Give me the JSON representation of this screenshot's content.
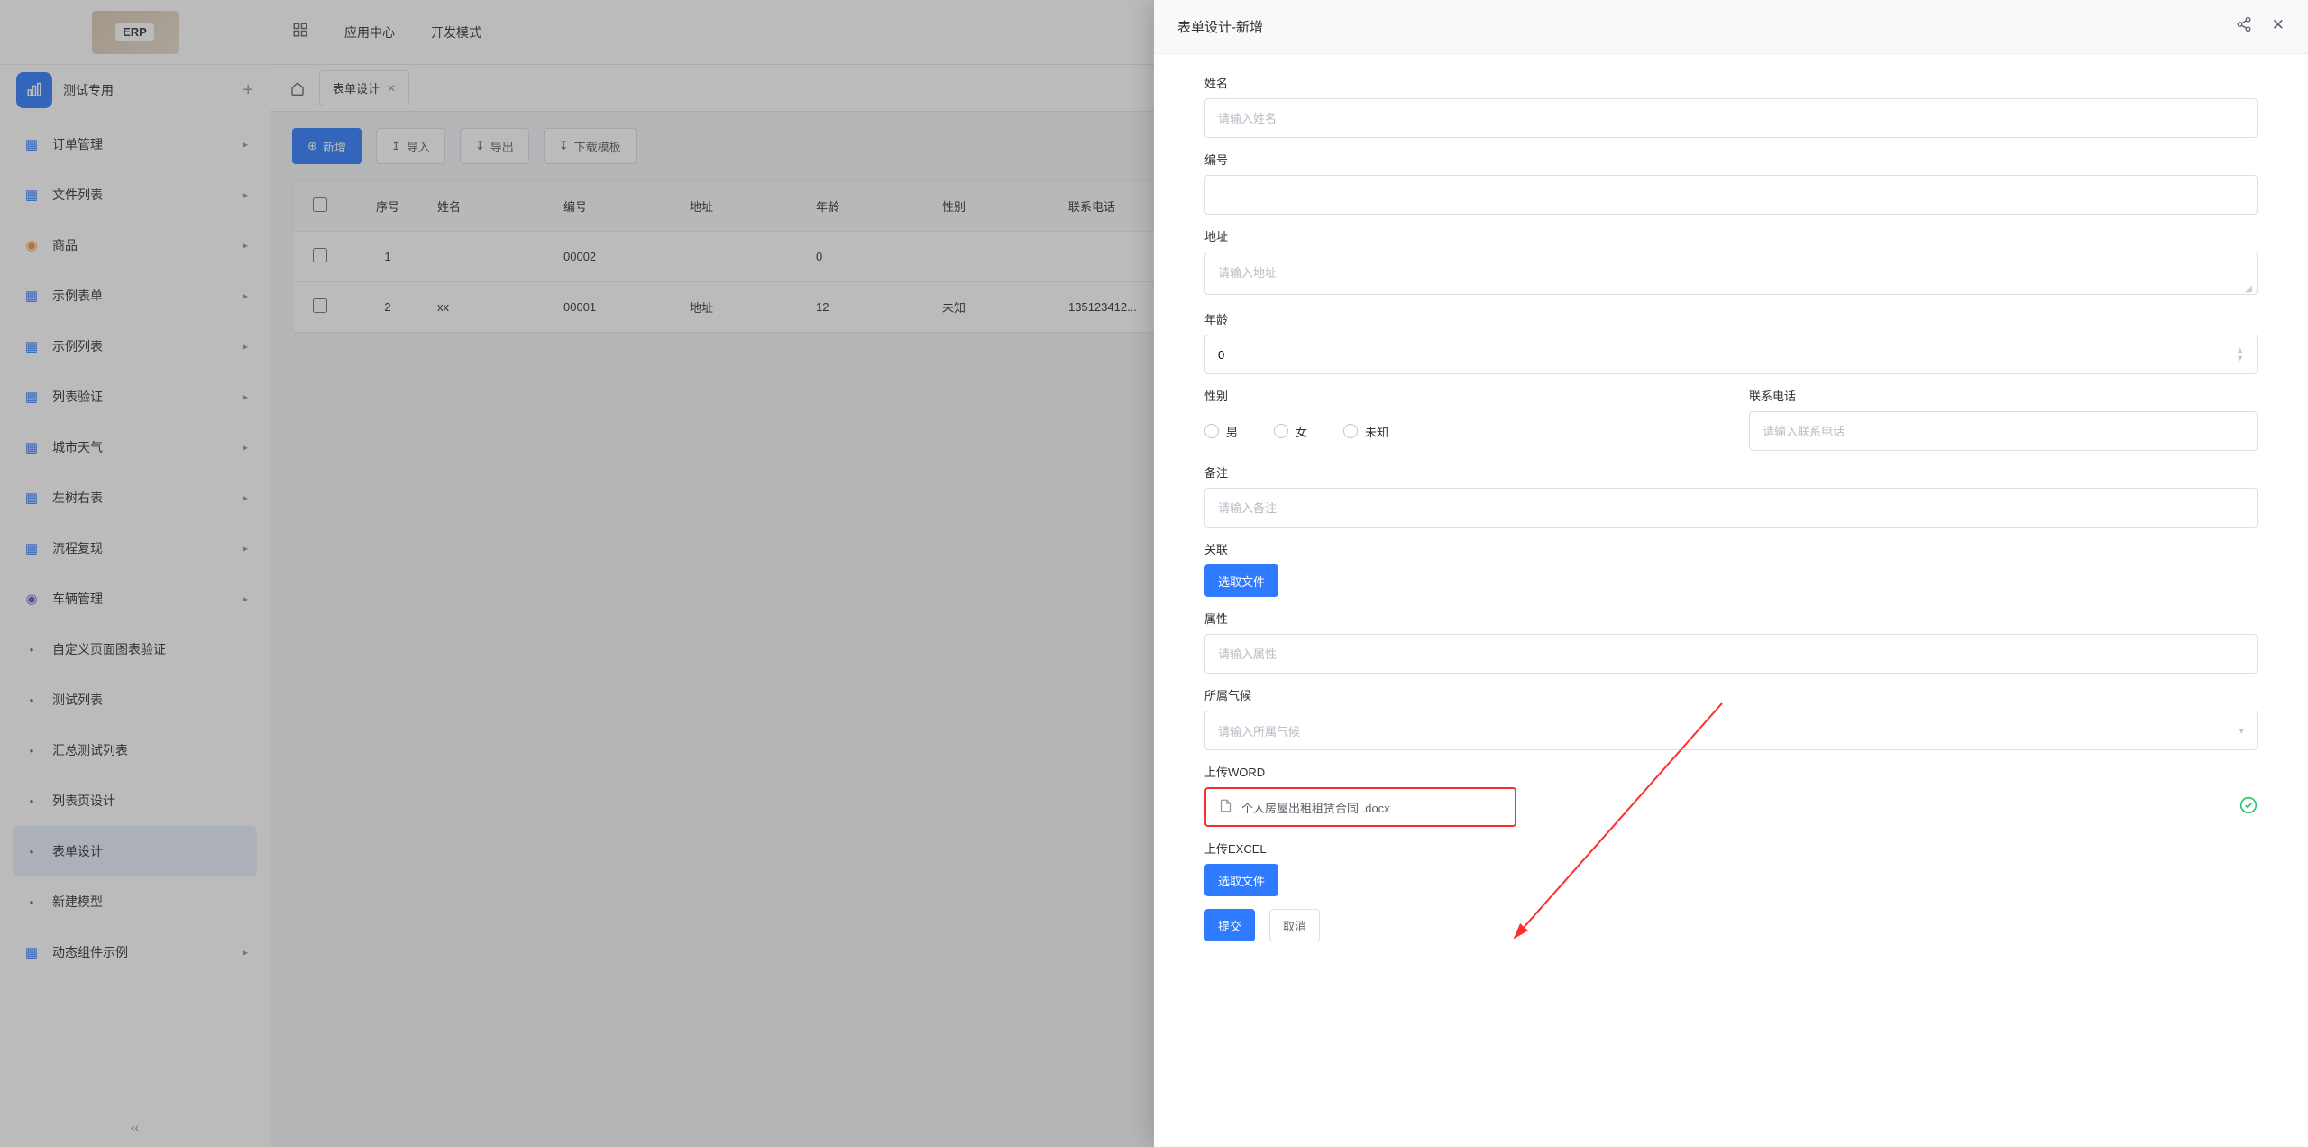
{
  "logo": {
    "text": "ERP"
  },
  "workspace": {
    "title": "测试专用"
  },
  "sidebar": {
    "items": [
      {
        "label": "订单管理",
        "icon": "grid",
        "hasArrow": true
      },
      {
        "label": "文件列表",
        "icon": "grid",
        "hasArrow": true
      },
      {
        "label": "商品",
        "icon": "circle-orange",
        "hasArrow": true
      },
      {
        "label": "示例表单",
        "icon": "grid",
        "hasArrow": true
      },
      {
        "label": "示例列表",
        "icon": "grid",
        "hasArrow": true
      },
      {
        "label": "列表验证",
        "icon": "grid",
        "hasArrow": true
      },
      {
        "label": "城市天气",
        "icon": "grid",
        "hasArrow": true
      },
      {
        "label": "左树右表",
        "icon": "grid",
        "hasArrow": true
      },
      {
        "label": "流程复现",
        "icon": "grid",
        "hasArrow": true
      },
      {
        "label": "车辆管理",
        "icon": "circle-purple",
        "hasArrow": true
      },
      {
        "label": "自定义页面图表验证",
        "icon": "dot",
        "hasArrow": false
      },
      {
        "label": "测试列表",
        "icon": "dot",
        "hasArrow": false
      },
      {
        "label": "汇总测试列表",
        "icon": "dot",
        "hasArrow": false
      },
      {
        "label": "列表页设计",
        "icon": "dot",
        "hasArrow": false
      },
      {
        "label": "表单设计",
        "icon": "dot",
        "hasArrow": false,
        "active": true
      },
      {
        "label": "新建模型",
        "icon": "dot",
        "hasArrow": false
      },
      {
        "label": "动态组件示例",
        "icon": "grid",
        "hasArrow": true
      }
    ]
  },
  "topbar": {
    "app_center": "应用中心",
    "dev_mode": "开发模式"
  },
  "tabs": {
    "active": "表单设计"
  },
  "toolbar": {
    "add": "新增",
    "import": "导入",
    "export": "导出",
    "download_tpl": "下载模板"
  },
  "table": {
    "headers": {
      "idx": "序号",
      "name": "姓名",
      "code": "编号",
      "addr": "地址",
      "age": "年龄",
      "gender": "性别",
      "phone": "联系电话"
    },
    "rows": [
      {
        "idx": "1",
        "name": "",
        "code": "00002",
        "addr": "",
        "age": "0",
        "gender": "",
        "phone": ""
      },
      {
        "idx": "2",
        "name": "xx",
        "code": "00001",
        "addr": "地址",
        "age": "12",
        "gender": "未知",
        "phone": "13512341​2..."
      }
    ]
  },
  "drawer": {
    "title": "表单设计-新增",
    "fields": {
      "name": {
        "label": "姓名",
        "placeholder": "请输入姓名"
      },
      "code": {
        "label": "编号"
      },
      "addr": {
        "label": "地址",
        "placeholder": "请输入地址"
      },
      "age": {
        "label": "年龄",
        "value": "0"
      },
      "gender": {
        "label": "性别",
        "options": [
          "男",
          "女",
          "未知"
        ]
      },
      "phone": {
        "label": "联系电话",
        "placeholder": "请输入联系电话"
      },
      "remark": {
        "label": "备注",
        "placeholder": "请输入备注"
      },
      "relation": {
        "label": "关联",
        "button": "选取文件"
      },
      "attr": {
        "label": "属性",
        "placeholder": "请输入属性"
      },
      "climate": {
        "label": "所属气候",
        "placeholder": "请输入所属气候"
      },
      "upload_word": {
        "label": "上传WORD",
        "file_name": "个人房屋出租租赁合同 .docx"
      },
      "upload_excel": {
        "label": "上传EXCEL",
        "button": "选取文件"
      }
    },
    "footer": {
      "submit": "提交",
      "cancel": "取消"
    }
  }
}
